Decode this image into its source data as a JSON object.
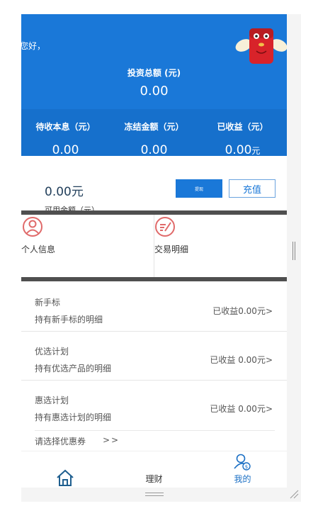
{
  "header": {
    "greeting": "您好，",
    "total_label": "投资总额 (元)",
    "total_value": "0.00",
    "stats": [
      {
        "label": "待收本息（元）",
        "value": "0.00",
        "unit": ""
      },
      {
        "label": "冻结金额（元）",
        "value": "0.00",
        "unit": ""
      },
      {
        "label": "已收益（元）",
        "value": "0.00",
        "unit": "元"
      }
    ]
  },
  "balance": {
    "value": "0.00元",
    "label": "可用余额（元）",
    "withdraw_label": "提现",
    "recharge_label": "充值"
  },
  "quick_links": [
    {
      "label": "个人信息",
      "icon": "user-icon"
    },
    {
      "label": "交易明细",
      "icon": "edit-list-icon"
    }
  ],
  "holdings": [
    {
      "title": "新手标",
      "subtitle": "持有新手标的明细",
      "earnings": "已收益0.00元>"
    },
    {
      "title": "优选计划",
      "subtitle": "持有优选产品的明细",
      "earnings": "已收益 0.00元>"
    },
    {
      "title": "惠选计划",
      "subtitle": "持有惠选计划的明细",
      "earnings": "已收益 0.00元>"
    }
  ],
  "coupon": {
    "label": "请选择优惠券",
    "arrow": ">>"
  },
  "tabs": [
    {
      "label": "",
      "icon": "home-icon"
    },
    {
      "label": "理财",
      "icon": ""
    },
    {
      "label": "我的",
      "icon": "user-money-icon"
    }
  ],
  "colors": {
    "primary": "#1a78d8",
    "stats_band": "#1670cc",
    "divider": "#4f4f4f",
    "icon_red": "#e06a6a"
  }
}
